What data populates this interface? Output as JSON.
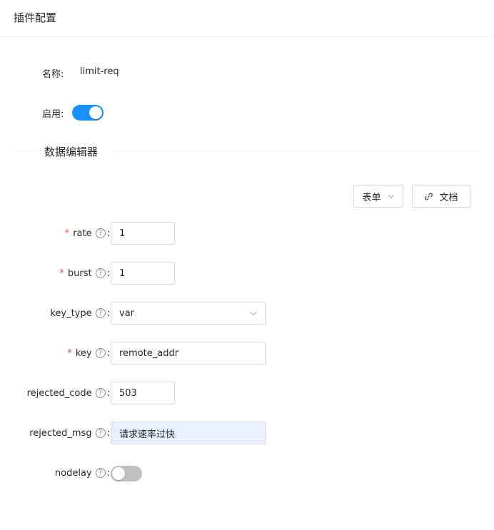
{
  "header": {
    "title": "插件配置"
  },
  "name_row": {
    "label": "名称:",
    "value": "limit-req"
  },
  "enable_row": {
    "label": "启用:",
    "enabled": true
  },
  "divider": {
    "title": "数据编辑器"
  },
  "toolbar": {
    "mode_label": "表单",
    "docs_label": "文档"
  },
  "fields": {
    "rate": {
      "label": "rate",
      "required": true,
      "value": "1"
    },
    "burst": {
      "label": "burst",
      "required": true,
      "value": "1"
    },
    "key_type": {
      "label": "key_type",
      "required": false,
      "value": "var"
    },
    "key": {
      "label": "key",
      "required": true,
      "value": "remote_addr"
    },
    "rejected_code": {
      "label": "rejected_code",
      "required": false,
      "value": "503"
    },
    "rejected_msg": {
      "label": "rejected_msg",
      "required": false,
      "value": "请求速率过快"
    },
    "nodelay": {
      "label": "nodelay",
      "required": false,
      "enabled": false
    }
  },
  "symbols": {
    "required_mark": "*",
    "help_mark": "?",
    "colon": ":"
  },
  "colors": {
    "primary": "#1890ff",
    "required": "#ff4d4f",
    "switch_off": "#bfbfbf",
    "autofill_bg": "#e8f0fe"
  },
  "icons": [
    "question-circle-icon",
    "down-arrow-icon",
    "link-icon"
  ]
}
